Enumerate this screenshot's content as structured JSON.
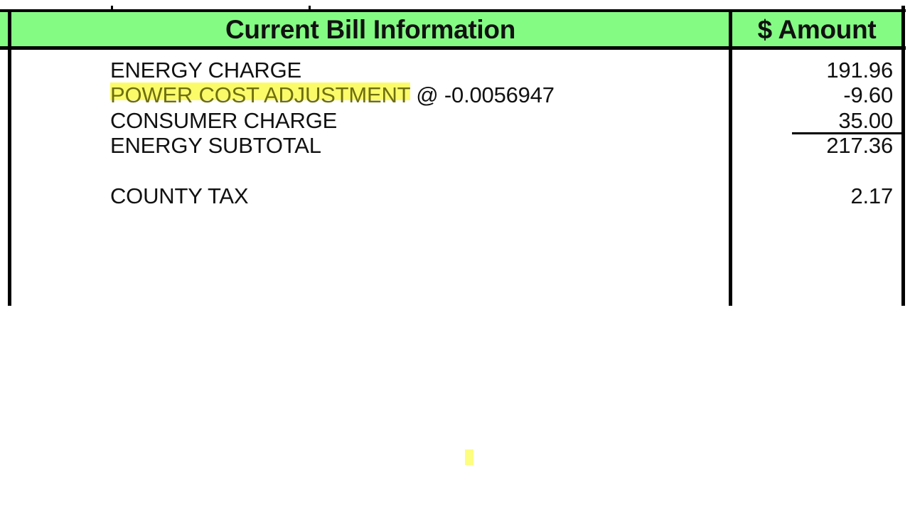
{
  "header": {
    "description_label": "Current Bill Information",
    "amount_label": "$ Amount",
    "background_color": "#84fc84"
  },
  "line_items": [
    {
      "description": "ENERGY CHARGE",
      "amount": "191.96"
    },
    {
      "description": "POWER COST ADJUSTMENT",
      "rate": "@ -0.0056947",
      "amount": "-9.60",
      "highlighted": true,
      "highlight_color": "#fbfb6a"
    },
    {
      "description": "CONSUMER CHARGE",
      "amount": "35.00"
    },
    {
      "description": "ENERGY SUBTOTAL",
      "amount": "217.36",
      "subtotal": true
    },
    {
      "description": "COUNTY TAX",
      "amount": "2.17"
    }
  ]
}
